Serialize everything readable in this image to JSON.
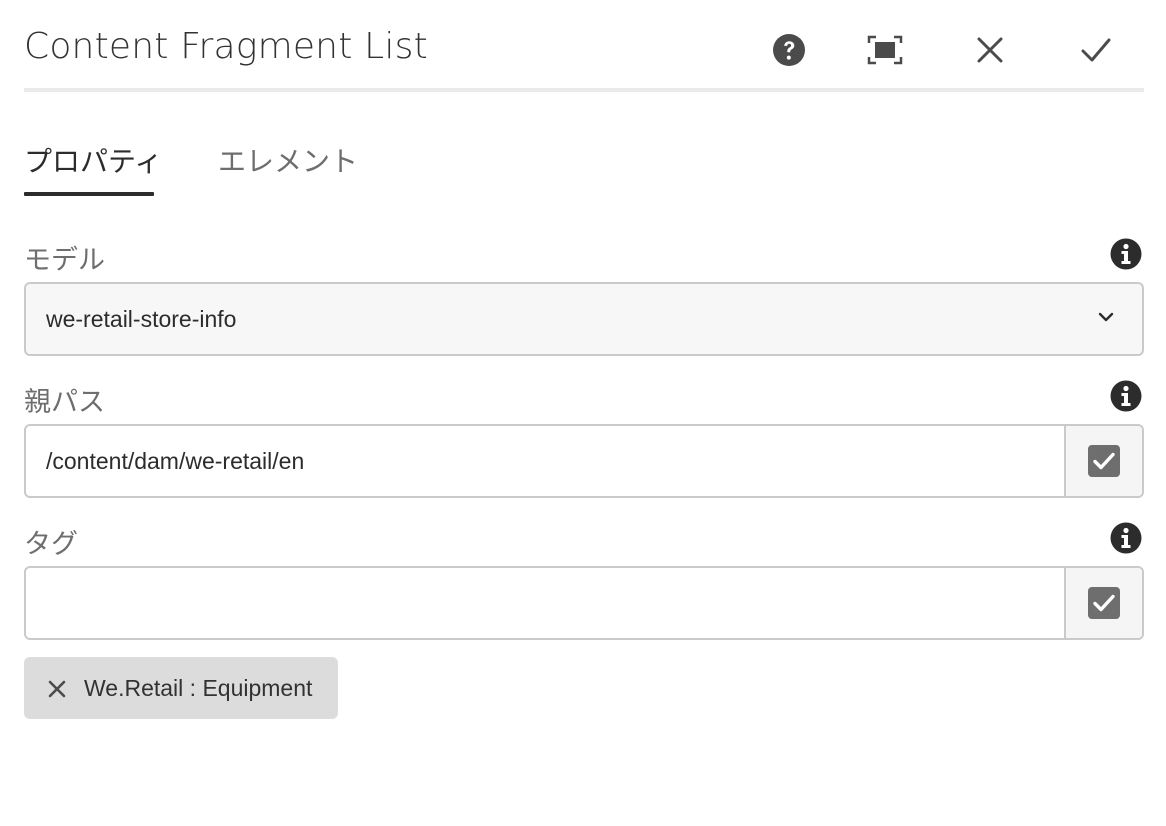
{
  "dialog": {
    "title": "Content Fragment List",
    "actions": {
      "help": "help-icon",
      "fullscreen": "fullscreen-icon",
      "cancel": "close-icon",
      "done": "checkmark-icon"
    }
  },
  "tabs": [
    {
      "label": "プロパティ",
      "active": true
    },
    {
      "label": "エレメント",
      "active": false
    }
  ],
  "fields": {
    "model": {
      "label": "モデル",
      "value": "we-retail-store-info"
    },
    "parent_path": {
      "label": "親パス",
      "value": "/content/dam/we-retail/en"
    },
    "tags": {
      "label": "タグ",
      "value": ""
    }
  },
  "selected_tags": [
    {
      "label": "We.Retail : Equipment"
    }
  ],
  "colors": {
    "text": "#2c2c2c",
    "muted": "#6e6e6e",
    "border": "#cacaca",
    "chip": "#dcdcdc",
    "icon": "#4b4b4b"
  }
}
